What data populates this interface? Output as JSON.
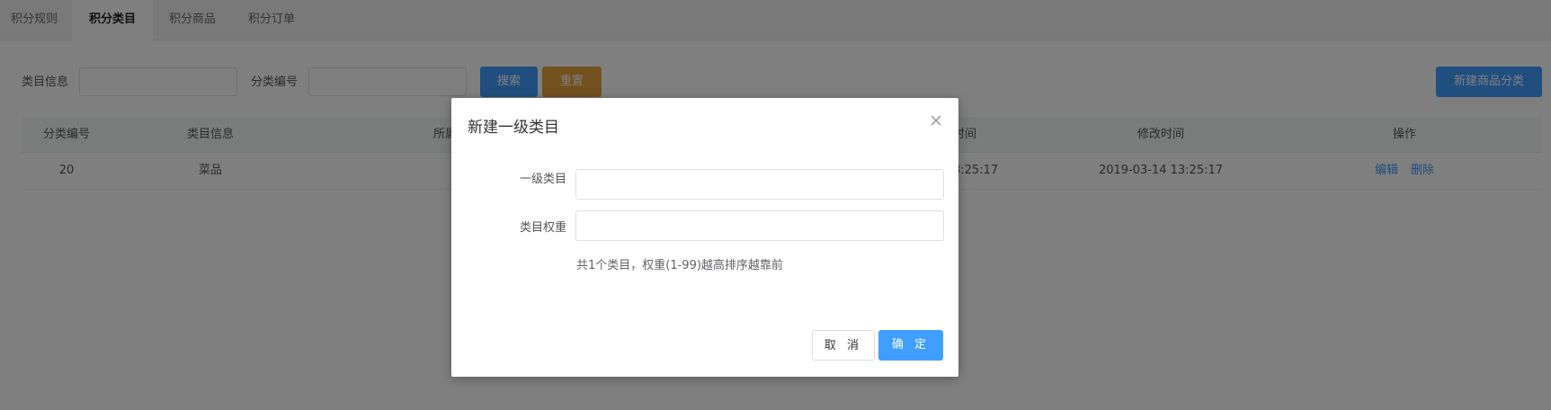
{
  "tabs": [
    {
      "label": "积分规则",
      "active": false
    },
    {
      "label": "积分类目",
      "active": true
    },
    {
      "label": "积分商品",
      "active": false
    },
    {
      "label": "积分订单",
      "active": false
    }
  ],
  "filter": {
    "category_info_label": "类目信息",
    "category_info_value": "",
    "category_code_label": "分类编号",
    "category_code_value": "",
    "search_label": "搜索",
    "reset_label": "重置",
    "new_label": "新建商品分类"
  },
  "table": {
    "headers": {
      "code": "分类编号",
      "info": "类目信息",
      "parent": "所属",
      "created": "时间",
      "modified": "修改时间",
      "actions": "操作"
    },
    "rows": [
      {
        "code": "20",
        "info": "菜品",
        "created": "3:25:17",
        "modified": "2019-03-14 13:25:17",
        "edit": "编辑",
        "delete": "删除"
      }
    ]
  },
  "dialog": {
    "title": "新建一级类目",
    "close_icon": "close-icon",
    "level1_label": "一级类目",
    "level1_value": "",
    "weight_label": "类目权重",
    "weight_value": "",
    "hint": "共1个类目，权重(1-99)越高排序越靠前",
    "cancel_label": "取 消",
    "ok_label": "确 定"
  },
  "colors": {
    "primary": "#409eff",
    "warning": "#e6a23c",
    "overlay": "rgba(0,0,0,0.5)"
  }
}
